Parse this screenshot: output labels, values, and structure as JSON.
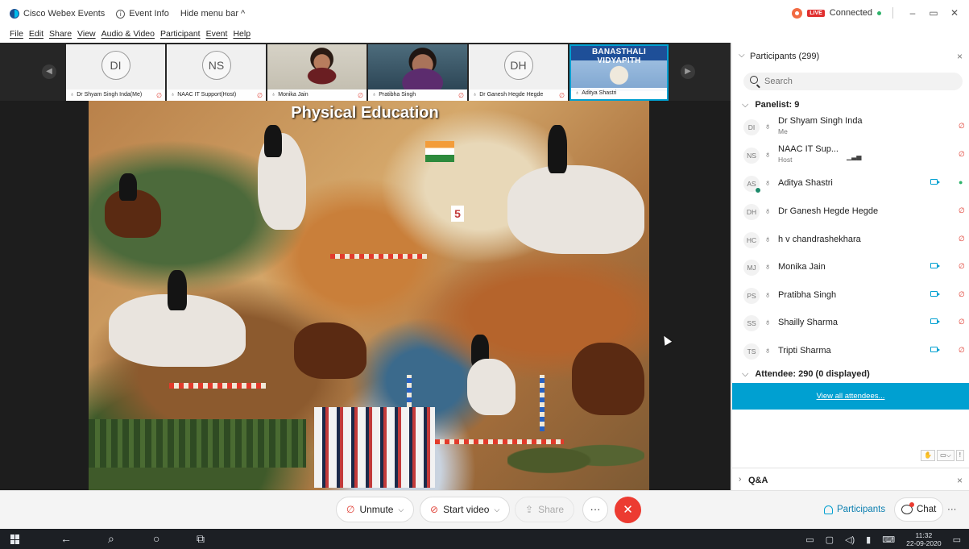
{
  "titlebar": {
    "app_title": "Cisco Webex Events",
    "event_info": "Event Info",
    "hide_menu": "Hide menu bar ^",
    "live_badge": "LIVE",
    "connection_status": "Connected",
    "minimize": "–",
    "maximize": "▭",
    "close": "✕"
  },
  "menu": [
    "File",
    "Edit",
    "Share",
    "View",
    "Audio & Video",
    "Participant",
    "Event",
    "Help"
  ],
  "thumbnails": [
    {
      "initials": "DI",
      "caption": "Dr Shyam Singh Inda(Me)"
    },
    {
      "initials": "NS",
      "caption": "NAAC IT Support(Host)"
    },
    {
      "initials": "",
      "caption": "Monika Jain"
    },
    {
      "initials": "",
      "caption": "Pratibha Singh"
    },
    {
      "initials": "DH",
      "caption": "Dr Ganesh Hegde Hegde"
    },
    {
      "initials": "",
      "caption": "Aditya Shastri",
      "banner": "BANASTHALI VIDYAPITH"
    }
  ],
  "slide": {
    "title": "Physical Education",
    "flag_number": "5"
  },
  "panel": {
    "title": "Participants (299)",
    "search_placeholder": "Search",
    "panelist_header": "Panelist: 9",
    "attendee_header": "Attendee: 290 (0 displayed)",
    "view_all": "View all attendees...",
    "qa_title": "Q&A"
  },
  "panelists": [
    {
      "initials": "DI",
      "name": "Dr Shyam Singh Inda",
      "role": "Me",
      "video": false,
      "audio": "muted"
    },
    {
      "initials": "NS",
      "name": "NAAC IT Sup...",
      "role": "Host",
      "video": false,
      "audio": "muted"
    },
    {
      "initials": "AS",
      "name": "Aditya Shastri",
      "role": "",
      "video": true,
      "audio": "live"
    },
    {
      "initials": "DH",
      "name": "Dr Ganesh Hegde Hegde",
      "role": "",
      "video": false,
      "audio": "muted"
    },
    {
      "initials": "HC",
      "name": "h v chandrashekhara",
      "role": "",
      "video": false,
      "audio": "muted"
    },
    {
      "initials": "MJ",
      "name": "Monika Jain",
      "role": "",
      "video": true,
      "audio": "muted"
    },
    {
      "initials": "PS",
      "name": "Pratibha Singh",
      "role": "",
      "video": true,
      "audio": "muted"
    },
    {
      "initials": "SS",
      "name": "Shailly Sharma",
      "role": "",
      "video": true,
      "audio": "muted"
    },
    {
      "initials": "TS",
      "name": "Tripti Sharma",
      "role": "",
      "video": true,
      "audio": "muted"
    }
  ],
  "controls": {
    "unmute": "Unmute",
    "start_video": "Start video",
    "share": "Share",
    "more": "···",
    "end": "✕",
    "participants": "Participants",
    "chat": "Chat",
    "more_right": "···"
  },
  "taskbar": {
    "time": "11:32",
    "date": "22-09-2020"
  },
  "colors": {
    "accent": "#00a0d1",
    "end_call": "#ec3b31",
    "muted": "#e0443a",
    "unmuted": "#2fb36b"
  }
}
